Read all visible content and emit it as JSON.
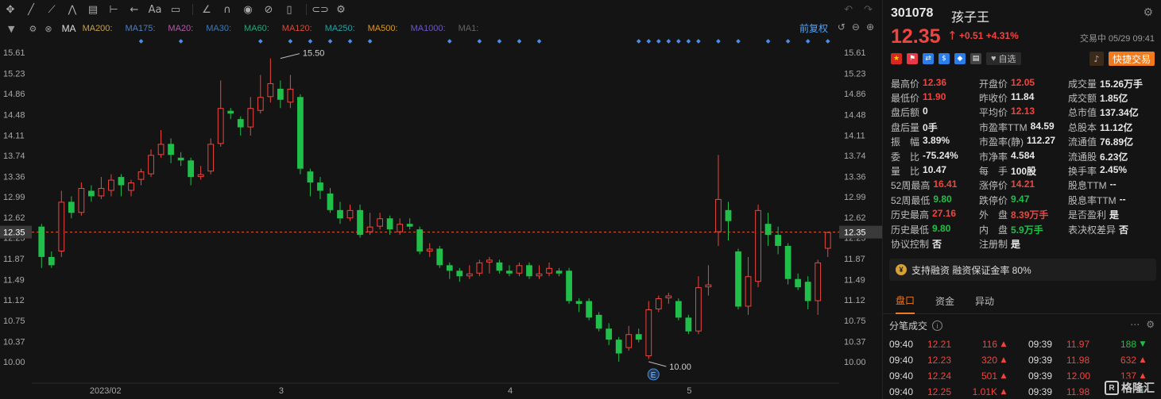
{
  "toolbar": {
    "tools": [
      "move-icon",
      "line-icon",
      "multiline-icon",
      "zigzag-icon",
      "fib-icon",
      "range-icon",
      "arrow-icon",
      "text-icon",
      "note-icon",
      "ruler-icon",
      "magnet-icon",
      "eye-icon",
      "eye-off-icon",
      "trash-icon",
      "link-icon",
      "settings-icon"
    ]
  },
  "ma_bar": {
    "label": "MA",
    "items": [
      {
        "label": "MA200:",
        "color": "#c8a046"
      },
      {
        "label": "MA175:",
        "color": "#4a7fc0"
      },
      {
        "label": "MA20:",
        "color": "#b25aa8"
      },
      {
        "label": "MA30:",
        "color": "#3f79b5"
      },
      {
        "label": "MA60:",
        "color": "#2fa07c"
      },
      {
        "label": "MA120:",
        "color": "#c7513e"
      },
      {
        "label": "MA250:",
        "color": "#2c9c9c"
      },
      {
        "label": "MA500:",
        "color": "#d49a28"
      },
      {
        "label": "MA1000:",
        "color": "#6d5ab8"
      },
      {
        "label": "MA1:",
        "color": "#666666"
      }
    ],
    "adjust_label": "前复权"
  },
  "chart_data": {
    "type": "candlestick",
    "y_ticks": [
      "15.61",
      "15.23",
      "14.86",
      "14.48",
      "14.11",
      "13.74",
      "13.36",
      "12.99",
      "12.62",
      "12.25",
      "11.87",
      "11.49",
      "11.12",
      "10.75",
      "10.37",
      "10.00"
    ],
    "ylim": [
      10.0,
      15.61
    ],
    "x_labels": [
      {
        "label": "2023/02",
        "index": 5
      },
      {
        "label": "3",
        "index": 24
      },
      {
        "label": "4",
        "index": 47
      },
      {
        "label": "5",
        "index": 65
      }
    ],
    "current_price_label": "12.35",
    "current_price": 12.35,
    "high_annotation": {
      "label": "15.50",
      "index": 24,
      "value": 15.5
    },
    "low_annotation": {
      "label": "10.00",
      "index": 61,
      "value": 10.0
    },
    "event_marker": {
      "label": "E",
      "index": 61
    },
    "candles": [
      [
        12.45,
        11.9,
        12.5,
        11.7
      ],
      [
        11.9,
        11.75,
        12.0,
        11.7
      ],
      [
        12.0,
        12.9,
        13.1,
        11.9
      ],
      [
        12.9,
        12.7,
        13.0,
        12.6
      ],
      [
        12.7,
        13.15,
        13.25,
        12.65
      ],
      [
        13.1,
        13.0,
        13.2,
        12.9
      ],
      [
        13.0,
        13.15,
        13.35,
        12.95
      ],
      [
        13.1,
        13.3,
        13.4,
        13.0
      ],
      [
        13.35,
        13.2,
        13.4,
        13.0
      ],
      [
        13.1,
        13.25,
        13.3,
        13.0
      ],
      [
        13.3,
        13.45,
        13.5,
        13.2
      ],
      [
        13.4,
        13.75,
        13.85,
        13.35
      ],
      [
        13.75,
        13.95,
        14.2,
        13.7
      ],
      [
        13.95,
        13.75,
        14.05,
        13.6
      ],
      [
        13.7,
        13.65,
        13.8,
        13.55
      ],
      [
        13.65,
        13.35,
        13.7,
        13.2
      ],
      [
        13.35,
        13.4,
        13.55,
        13.3
      ],
      [
        13.45,
        13.95,
        14.05,
        13.4
      ],
      [
        13.95,
        14.6,
        15.1,
        13.9
      ],
      [
        14.55,
        14.5,
        14.6,
        14.4
      ],
      [
        14.4,
        14.25,
        14.45,
        14.1
      ],
      [
        14.25,
        14.6,
        14.8,
        14.1
      ],
      [
        14.55,
        14.8,
        15.2,
        14.5
      ],
      [
        14.8,
        15.05,
        15.5,
        14.7
      ],
      [
        14.95,
        14.75,
        15.1,
        14.6
      ],
      [
        14.7,
        14.95,
        15.2,
        14.6
      ],
      [
        14.8,
        13.5,
        14.85,
        13.4
      ],
      [
        13.45,
        13.25,
        13.5,
        13.0
      ],
      [
        13.25,
        13.1,
        13.35,
        12.95
      ],
      [
        13.05,
        12.75,
        13.15,
        12.7
      ],
      [
        12.75,
        12.6,
        12.9,
        12.5
      ],
      [
        12.6,
        12.75,
        12.85,
        12.55
      ],
      [
        12.75,
        12.3,
        12.85,
        12.25
      ],
      [
        12.35,
        12.45,
        12.7,
        12.3
      ],
      [
        12.45,
        12.6,
        12.7,
        12.4
      ],
      [
        12.6,
        12.4,
        12.65,
        12.3
      ],
      [
        12.35,
        12.5,
        12.6,
        12.3
      ],
      [
        12.5,
        12.45,
        12.6,
        12.4
      ],
      [
        12.4,
        12.0,
        12.45,
        11.95
      ],
      [
        12.0,
        12.05,
        12.15,
        11.9
      ],
      [
        12.05,
        11.75,
        12.1,
        11.7
      ],
      [
        11.75,
        11.65,
        11.8,
        11.5
      ],
      [
        11.65,
        11.55,
        11.7,
        11.45
      ],
      [
        11.55,
        11.6,
        11.75,
        11.5
      ],
      [
        11.6,
        11.8,
        11.85,
        11.55
      ],
      [
        11.8,
        11.85,
        11.9,
        11.6
      ],
      [
        11.8,
        11.65,
        11.85,
        11.6
      ],
      [
        11.65,
        11.6,
        11.75,
        11.55
      ],
      [
        11.6,
        11.75,
        11.8,
        11.55
      ],
      [
        11.75,
        11.55,
        11.8,
        11.5
      ],
      [
        11.55,
        11.6,
        11.75,
        11.5
      ],
      [
        11.6,
        11.7,
        11.8,
        11.55
      ],
      [
        11.65,
        11.6,
        11.7,
        11.55
      ],
      [
        11.65,
        11.1,
        11.7,
        11.05
      ],
      [
        11.1,
        11.05,
        11.15,
        10.9
      ],
      [
        11.1,
        10.8,
        11.15,
        10.75
      ],
      [
        10.85,
        10.6,
        10.9,
        10.55
      ],
      [
        10.6,
        10.4,
        10.7,
        10.3
      ],
      [
        10.4,
        10.15,
        10.45,
        10.0
      ],
      [
        10.25,
        10.5,
        10.65,
        10.2
      ],
      [
        10.5,
        10.4,
        10.6,
        10.35
      ],
      [
        10.1,
        10.95,
        11.1,
        10.05
      ],
      [
        10.95,
        11.15,
        11.2,
        10.9
      ],
      [
        11.15,
        11.2,
        11.25,
        11.05
      ],
      [
        11.1,
        10.8,
        11.15,
        10.75
      ],
      [
        10.8,
        10.55,
        10.85,
        10.5
      ],
      [
        10.55,
        11.35,
        11.55,
        10.5
      ],
      [
        11.35,
        11.4,
        11.75,
        11.2
      ],
      [
        12.35,
        12.95,
        13.75,
        12.1
      ],
      [
        12.75,
        12.55,
        12.9,
        12.2
      ],
      [
        12.0,
        11.0,
        12.05,
        10.95
      ],
      [
        11.0,
        11.55,
        11.9,
        10.85
      ],
      [
        11.45,
        12.75,
        12.85,
        11.35
      ],
      [
        12.5,
        12.3,
        12.7,
        12.1
      ],
      [
        12.3,
        12.1,
        12.45,
        11.95
      ],
      [
        12.1,
        11.5,
        12.15,
        11.4
      ],
      [
        11.5,
        11.35,
        11.6,
        11.3
      ],
      [
        11.45,
        11.1,
        11.55,
        10.95
      ],
      [
        11.1,
        11.8,
        11.85,
        10.85
      ],
      [
        12.05,
        12.35,
        12.36,
        11.9
      ]
    ]
  },
  "quote": {
    "code": "301078",
    "name": "孩子王",
    "price": "12.35",
    "change": "+0.51",
    "change_pct": "+4.31%",
    "status": "交易中 05/29 09:41",
    "watchlist_label": "自选",
    "quick_trade_label": "快捷交易"
  },
  "stats": [
    [
      [
        "最高价",
        "12.36",
        "red"
      ],
      [
        "开盘价",
        "12.05",
        "red"
      ],
      [
        "成交量",
        "15.26万手",
        ""
      ]
    ],
    [
      [
        "最低价",
        "11.90",
        "red"
      ],
      [
        "昨收价",
        "11.84",
        ""
      ],
      [
        "成交额",
        "1.85亿",
        ""
      ]
    ],
    [
      [
        "盘后额",
        "0",
        ""
      ],
      [
        "平均价",
        "12.13",
        "red"
      ],
      [
        "总市值",
        "137.34亿",
        ""
      ]
    ],
    [
      [
        "盘后量",
        "0手",
        ""
      ],
      [
        "市盈率TTM",
        "84.59",
        ""
      ],
      [
        "总股本",
        "11.12亿",
        ""
      ]
    ],
    [
      [
        "振　幅",
        "3.89%",
        ""
      ],
      [
        "市盈率(静)",
        "112.27",
        ""
      ],
      [
        "流通值",
        "76.89亿",
        ""
      ]
    ],
    [
      [
        "委　比",
        "-75.24%",
        ""
      ],
      [
        "市净率",
        "4.584",
        ""
      ],
      [
        "流通股",
        "6.23亿",
        ""
      ]
    ],
    [
      [
        "量　比",
        "10.47",
        ""
      ],
      [
        "每　手",
        "100股",
        ""
      ],
      [
        "换手率",
        "2.45%",
        ""
      ]
    ],
    [
      [
        "52周最高",
        "16.41",
        "red"
      ],
      [
        "涨停价",
        "14.21",
        "red"
      ],
      [
        "股息TTM",
        "--",
        ""
      ]
    ],
    [
      [
        "52周最低",
        "9.80",
        "green"
      ],
      [
        "跌停价",
        "9.47",
        "green"
      ],
      [
        "股息率TTM",
        "--",
        ""
      ]
    ],
    [
      [
        "历史最高",
        "27.16",
        "red"
      ],
      [
        "外　盘",
        "8.39万手",
        "red"
      ],
      [
        "是否盈利",
        "是",
        ""
      ]
    ],
    [
      [
        "历史最低",
        "9.80",
        "green"
      ],
      [
        "内　盘",
        "5.9万手",
        "green"
      ],
      [
        "表决权差异",
        "否",
        ""
      ]
    ],
    [
      [
        "协议控制",
        "否",
        ""
      ],
      [
        "注册制",
        "是",
        ""
      ],
      [
        "",
        "",
        ""
      ]
    ]
  ],
  "margin": {
    "text": "支持融资 融资保证金率 80%",
    "icon": "¥"
  },
  "tabs": [
    "盘口",
    "资金",
    "异动"
  ],
  "ticks_header": "分笔成交",
  "ticks": [
    [
      [
        "09:40",
        "12.21",
        "116",
        "up"
      ],
      [
        "09:39",
        "11.97",
        "188",
        "down"
      ]
    ],
    [
      [
        "09:40",
        "12.23",
        "320",
        "up"
      ],
      [
        "09:39",
        "11.98",
        "632",
        "up"
      ]
    ],
    [
      [
        "09:40",
        "12.24",
        "501",
        "up"
      ],
      [
        "09:39",
        "12.00",
        "137",
        "up"
      ]
    ],
    [
      [
        "09:40",
        "12.25",
        "1.01K",
        "up"
      ],
      [
        "09:39",
        "11.98",
        "",
        "down"
      ]
    ]
  ],
  "logo_text": "格隆汇",
  "colors": {
    "up": "#f0443e",
    "down": "#1fbf4a",
    "accent": "#f07a1e",
    "link": "#4ea3ff"
  }
}
